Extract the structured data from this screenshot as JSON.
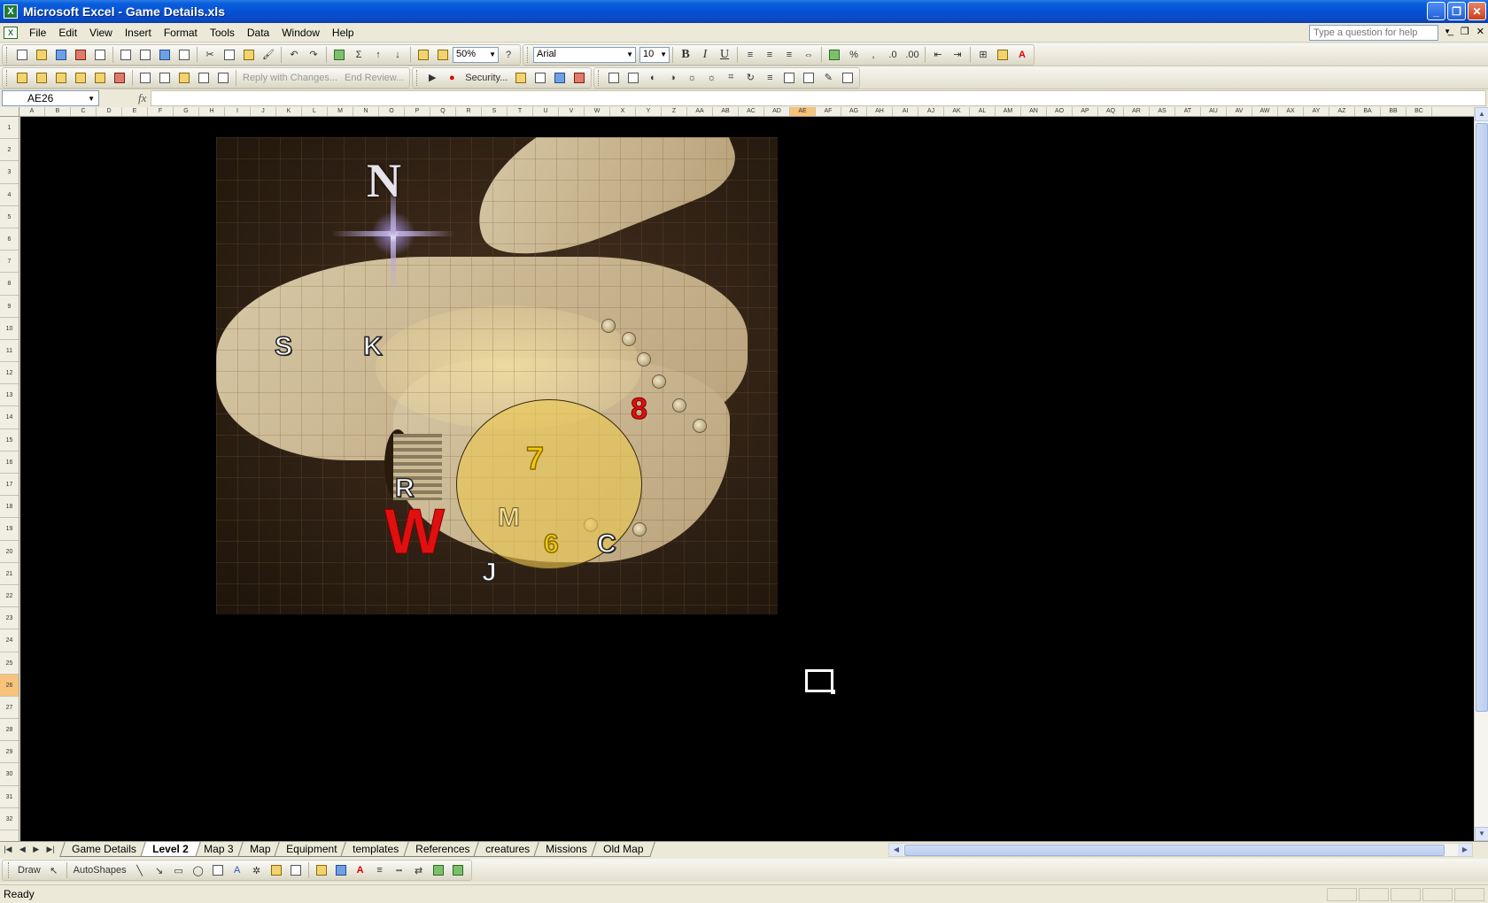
{
  "window": {
    "title": "Microsoft Excel - Game Details.xls",
    "app_letter": "X"
  },
  "menu": {
    "items": [
      "File",
      "Edit",
      "View",
      "Insert",
      "Format",
      "Tools",
      "Data",
      "Window",
      "Help"
    ],
    "help_placeholder": "Type a question for help"
  },
  "toolbar": {
    "zoom": "50%",
    "font_name": "Arial",
    "font_size": "10",
    "bold": "B",
    "italic": "I",
    "underline": "U",
    "percent": "%",
    "comma": ",",
    "reply_with_changes": "Reply with Changes...",
    "end_review": "End Review...",
    "security": "Security..."
  },
  "formula_bar": {
    "name_box": "AE26",
    "fx": "fx",
    "value": ""
  },
  "columns": [
    "A",
    "B",
    "C",
    "D",
    "E",
    "F",
    "G",
    "H",
    "I",
    "J",
    "K",
    "L",
    "M",
    "N",
    "O",
    "P",
    "Q",
    "R",
    "S",
    "T",
    "U",
    "V",
    "W",
    "X",
    "Y",
    "Z",
    "AA",
    "AB",
    "AC",
    "AD",
    "AE",
    "AF",
    "AG",
    "AH",
    "AI",
    "AJ",
    "AK",
    "AL",
    "AM",
    "AN",
    "AO",
    "AP",
    "AQ",
    "AR",
    "AS",
    "AT",
    "AU",
    "AV",
    "AW",
    "AX",
    "AY",
    "AZ",
    "BA",
    "BB",
    "BC"
  ],
  "selected_column": "AE",
  "rows": [
    "1",
    "2",
    "3",
    "4",
    "5",
    "6",
    "7",
    "8",
    "9",
    "10",
    "11",
    "12",
    "13",
    "14",
    "15",
    "16",
    "17",
    "18",
    "19",
    "20",
    "21",
    "22",
    "23",
    "24",
    "25",
    "26",
    "27",
    "28",
    "29",
    "30",
    "31",
    "32"
  ],
  "selected_row": "26",
  "map_markers": {
    "compass": "N",
    "s": "S",
    "k": "K",
    "r": "R",
    "w": "W",
    "j": "J",
    "c": "C",
    "m": "M",
    "seven": "7",
    "six": "6",
    "eight": "8"
  },
  "sheet_tabs": [
    "Game Details",
    "Level 2",
    "Map 3",
    "Map",
    "Equipment",
    "templates",
    "References",
    "creatures",
    "Missions",
    "Old Map"
  ],
  "active_tab": "Level 2",
  "draw_toolbar": {
    "draw": "Draw",
    "autoshapes": "AutoShapes"
  },
  "status": {
    "text": "Ready"
  },
  "colors": {
    "titlebar": "#0552d6",
    "sheet_bg": "#000000",
    "marker_red": "#e01010",
    "marker_yellow": "#f2c90e",
    "circle_fill": "#ecc850"
  }
}
